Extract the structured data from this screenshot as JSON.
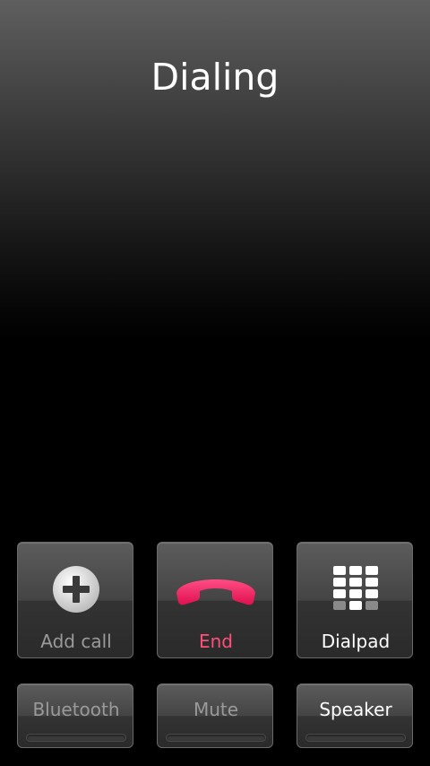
{
  "call": {
    "status": "Dialing"
  },
  "colors": {
    "end_red": "#ff1f63",
    "label_gray": "#9a9a9a",
    "label_white": "#ffffff"
  },
  "main_buttons": [
    {
      "label": "Add call",
      "icon": "add-call-icon",
      "enabled": false
    },
    {
      "label": "End",
      "icon": "end-call-phone-icon",
      "enabled": true
    },
    {
      "label": "Dialpad",
      "icon": "dialpad-icon",
      "enabled": true
    }
  ],
  "toggle_buttons": [
    {
      "label": "Bluetooth",
      "enabled": false
    },
    {
      "label": "Mute",
      "enabled": false
    },
    {
      "label": "Speaker",
      "enabled": true
    }
  ]
}
